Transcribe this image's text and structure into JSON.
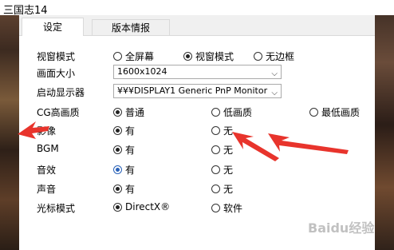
{
  "window": {
    "title": "三国志14"
  },
  "tabs": [
    "设定",
    "版本情报"
  ],
  "rows": {
    "window_mode": {
      "label": "视窗模式",
      "options": [
        "全屏幕",
        "视窗模式",
        "无边框"
      ]
    },
    "resolution": {
      "label": "画面大小",
      "value": "1600x1024"
    },
    "display": {
      "label": "启动显示器",
      "value": "¥¥¥DISPLAY1 Generic PnP Monitor"
    },
    "cg_quality": {
      "label": "CG高画质",
      "options": [
        "普通",
        "低画质",
        "最低画质"
      ]
    },
    "video": {
      "label": "影像",
      "options": [
        "有",
        "无"
      ]
    },
    "bgm": {
      "label": "BGM",
      "options": [
        "有",
        "无"
      ]
    },
    "sfx": {
      "label": "音效",
      "options": [
        "有",
        "无"
      ]
    },
    "voice": {
      "label": "声音",
      "options": [
        "有",
        "无"
      ]
    },
    "cursor": {
      "label": "光标模式",
      "options": [
        "DirectX®",
        "软件"
      ]
    }
  },
  "watermark": "Baidu经验",
  "colors": {
    "arrow": "#e8342c",
    "selected_blue": "#2a62b8"
  }
}
